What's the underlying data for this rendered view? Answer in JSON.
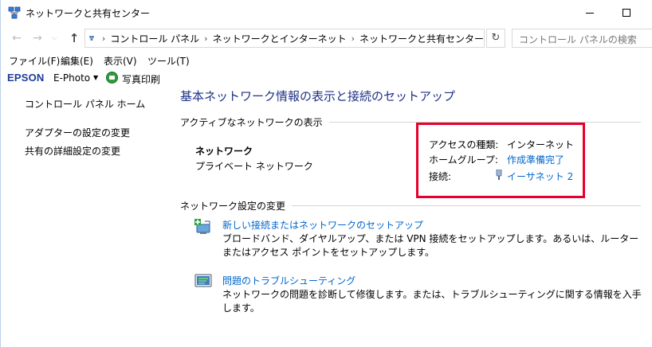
{
  "window": {
    "title": "ネットワークと共有センター",
    "icon": "network-icon"
  },
  "address": {
    "crumbs": [
      "コントロール パネル",
      "ネットワークとインターネット",
      "ネットワークと共有センター"
    ],
    "search_placeholder": "コントロール パネルの検索"
  },
  "menu": {
    "file": "ファイル(F)",
    "edit": "編集(E)",
    "view": "表示(V)",
    "tools": "ツール(T)"
  },
  "epson_toolbar": {
    "logo": "EPSON",
    "app": "E-Photo",
    "print_label": "写真印刷"
  },
  "sidebar": {
    "items": [
      {
        "label": "コントロール パネル ホーム"
      },
      {
        "label": "アダプターの設定の変更"
      },
      {
        "label": "共有の詳細設定の変更"
      }
    ]
  },
  "main": {
    "title": "基本ネットワーク情報の表示と接続のセットアップ",
    "active_section": "アクティブなネットワークの表示",
    "network_name": "ネットワーク",
    "network_type": "プライベート ネットワーク",
    "access_type_label": "アクセスの種類:",
    "access_type_value": "インターネット",
    "homegroup_label": "ホームグループ:",
    "homegroup_value": "作成準備完了",
    "connection_label": "接続:",
    "connection_value": "イーサネット 2",
    "settings_section": "ネットワーク設定の変更",
    "tasks": [
      {
        "label": "新しい接続またはネットワークのセットアップ",
        "description": "ブロードバンド、ダイヤルアップ、または VPN 接続をセットアップします。あるいは、ルーターまたはアクセス ポイントをセットアップします。"
      },
      {
        "label": "問題のトラブルシューティング",
        "description": "ネットワークの問題を診断して修復します。または、トラブルシューティングに関する情報を入手します。"
      }
    ]
  },
  "colors": {
    "title_blue": "#1e3287",
    "link_blue": "#0066cc",
    "highlight_red": "#e8002d",
    "epson_blue": "#1b3b9b"
  }
}
